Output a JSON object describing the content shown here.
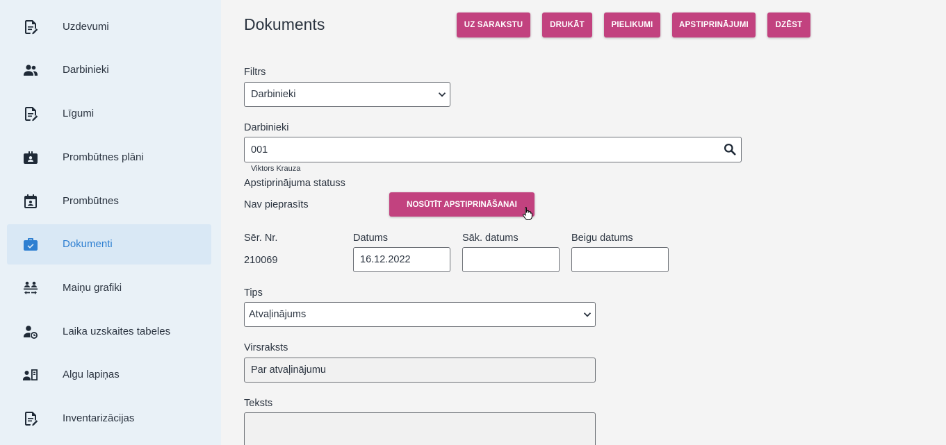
{
  "sidebar": {
    "items": [
      {
        "label": "Uzdevumi",
        "icon": "document-edit-icon",
        "active": false
      },
      {
        "label": "Darbinieki",
        "icon": "people-icon",
        "active": false
      },
      {
        "label": "Līgumi",
        "icon": "document-edit-icon",
        "active": false
      },
      {
        "label": "Prombūtnes plāni",
        "icon": "badge-briefcase-icon",
        "active": false
      },
      {
        "label": "Prombūtnes",
        "icon": "calendar-person-icon",
        "active": false
      },
      {
        "label": "Dokumenti",
        "icon": "briefcase-check-icon",
        "active": true
      },
      {
        "label": "Maiņu grafiki",
        "icon": "shift-swap-icon",
        "active": false
      },
      {
        "label": "Laika uzskaites tabeles",
        "icon": "person-clock-icon",
        "active": false
      },
      {
        "label": "Algu lapiņas",
        "icon": "person-payslip-icon",
        "active": false
      },
      {
        "label": "Inventarizācijas",
        "icon": "document-edit-icon",
        "active": false
      }
    ]
  },
  "header": {
    "title": "Dokuments",
    "buttons": {
      "back": "UZ SARAKSTU",
      "print": "DRUKĀT",
      "attachments": "PIELIKUMI",
      "approvals": "APSTIPRINĀJUMI",
      "delete": "DZĒST"
    }
  },
  "form": {
    "filter": {
      "label": "Filtrs",
      "value": "Darbinieki"
    },
    "employees": {
      "label": "Darbinieki",
      "value": "001",
      "hint": "Viktors Krauza"
    },
    "approval_status": {
      "label": "Apstiprinājuma statuss",
      "value": "Nav pieprasīts",
      "button": "NOSŪTĪT APSTIPRINĀŠANAI"
    },
    "serial": {
      "label": "Sēr. Nr.",
      "value": "210069"
    },
    "date": {
      "label": "Datums",
      "value": "16.12.2022"
    },
    "start_date": {
      "label": "Sāk. datums",
      "value": ""
    },
    "end_date": {
      "label": "Beigu datums",
      "value": ""
    },
    "type": {
      "label": "Tips",
      "value": "Atvaļinājums"
    },
    "heading": {
      "label": "Virsraksts",
      "value": "Par atvaļinājumu"
    },
    "text": {
      "label": "Teksts",
      "value": ""
    }
  },
  "colors": {
    "accent": "#c2427f",
    "sidebar_bg": "#e9f1f7",
    "active_blue": "#2e7fd1"
  }
}
